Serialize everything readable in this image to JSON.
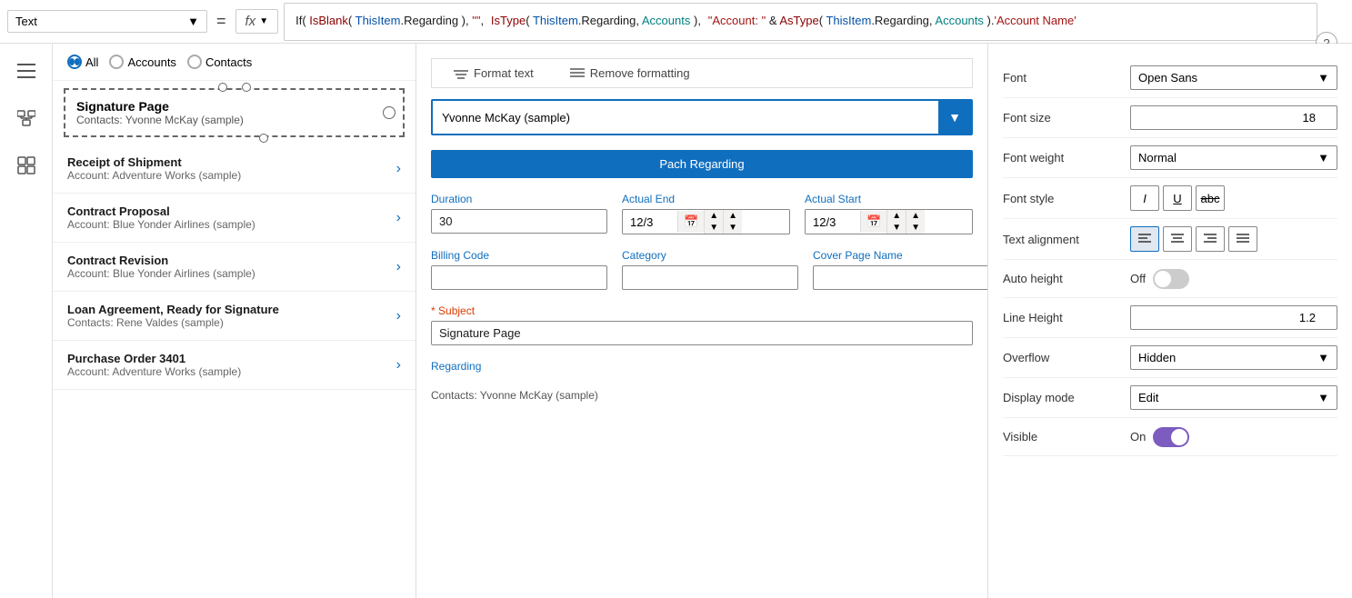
{
  "topbar": {
    "text_label": "Text",
    "equals": "=",
    "fx_label": "fx",
    "formula": "If( IsBlank( ThisItem.Regarding ), \"\",\n        IsType( ThisItem.Regarding, Accounts ),\n            \"Account: \" & AsType( ThisItem.Regarding, Accounts ).'Account Name',\n        IsType( ThisItem.Regarding, Contacts ),\n            \"Contacts: \" & AsType( ThisItem.Regarding, Contacts ).'Full Name',\n        \"\"\n    )"
  },
  "filter": {
    "options": [
      "All",
      "Accounts",
      "Contacts"
    ],
    "selected": "All"
  },
  "signature_page": {
    "title": "Signature Page",
    "subtitle": "Contacts: Yvonne McKay (sample)"
  },
  "list_items": [
    {
      "title": "Receipt of Shipment",
      "sub": "Account: Adventure Works (sample)"
    },
    {
      "title": "Contract Proposal",
      "sub": "Account: Blue Yonder Airlines (sample)"
    },
    {
      "title": "Contract Revision",
      "sub": "Account: Blue Yonder Airlines (sample)"
    },
    {
      "title": "Loan Agreement, Ready for Signature",
      "sub": "Contacts: Rene Valdes (sample)"
    },
    {
      "title": "Purchase Order 3401",
      "sub": "Account: Adventure Works (sample)"
    }
  ],
  "format_bar": {
    "format_text": "Format text",
    "remove_formatting": "Remove formatting"
  },
  "form": {
    "contact_value": "Yvonne McKay (sample)",
    "pach_btn": "Pach Regarding",
    "duration_label": "Duration",
    "duration_value": "30",
    "actual_end_label": "Actual End",
    "actual_end_value": "12/3",
    "actual_start_label": "Actual Start",
    "actual_start_value": "12/3",
    "billing_code_label": "Billing Code",
    "billing_code_value": "",
    "category_label": "Category",
    "category_value": "",
    "cover_page_name_label": "Cover Page Name",
    "cover_page_name_value": "",
    "subject_label": "Subject",
    "subject_required": true,
    "subject_value": "Signature Page",
    "regarding_label": "Regarding",
    "regarding_value": "Contacts: Yvonne McKay (sample)"
  },
  "properties": {
    "font_label": "Font",
    "font_value": "Open Sans",
    "font_size_label": "Font size",
    "font_size_value": "18",
    "font_weight_label": "Font weight",
    "font_weight_value": "Normal",
    "font_style_label": "Font style",
    "font_style_italic": "I",
    "font_style_underline": "U",
    "font_style_strikethrough": "abc",
    "text_alignment_label": "Text alignment",
    "align_left": "≡",
    "align_center": "≡",
    "align_right": "≡",
    "align_justify": "≡",
    "auto_height_label": "Auto height",
    "auto_height_value": "Off",
    "line_height_label": "Line Height",
    "line_height_value": "1.2",
    "overflow_label": "Overflow",
    "overflow_value": "Hidden",
    "display_mode_label": "Display mode",
    "display_mode_value": "Edit",
    "visible_label": "Visible",
    "visible_value": "On"
  }
}
